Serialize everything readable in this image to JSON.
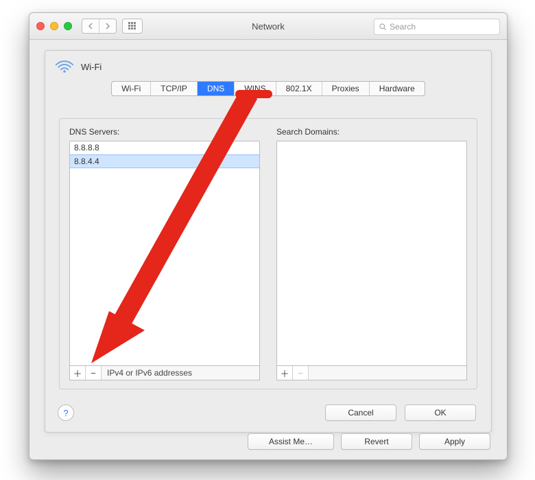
{
  "window_title": "Network",
  "search_placeholder": "Search",
  "connection_name": "Wi-Fi",
  "tabs": [
    "Wi-Fi",
    "TCP/IP",
    "DNS",
    "WINS",
    "802.1X",
    "Proxies",
    "Hardware"
  ],
  "active_tab_index": 2,
  "dns": {
    "label": "DNS Servers:",
    "entries": [
      "8.8.8.8",
      "8.8.4.4"
    ],
    "hint": "IPv4 or IPv6 addresses"
  },
  "search_domains": {
    "label": "Search Domains:",
    "entries": []
  },
  "buttons": {
    "cancel": "Cancel",
    "ok": "OK",
    "assist": "Assist Me…",
    "revert": "Revert",
    "apply": "Apply"
  }
}
